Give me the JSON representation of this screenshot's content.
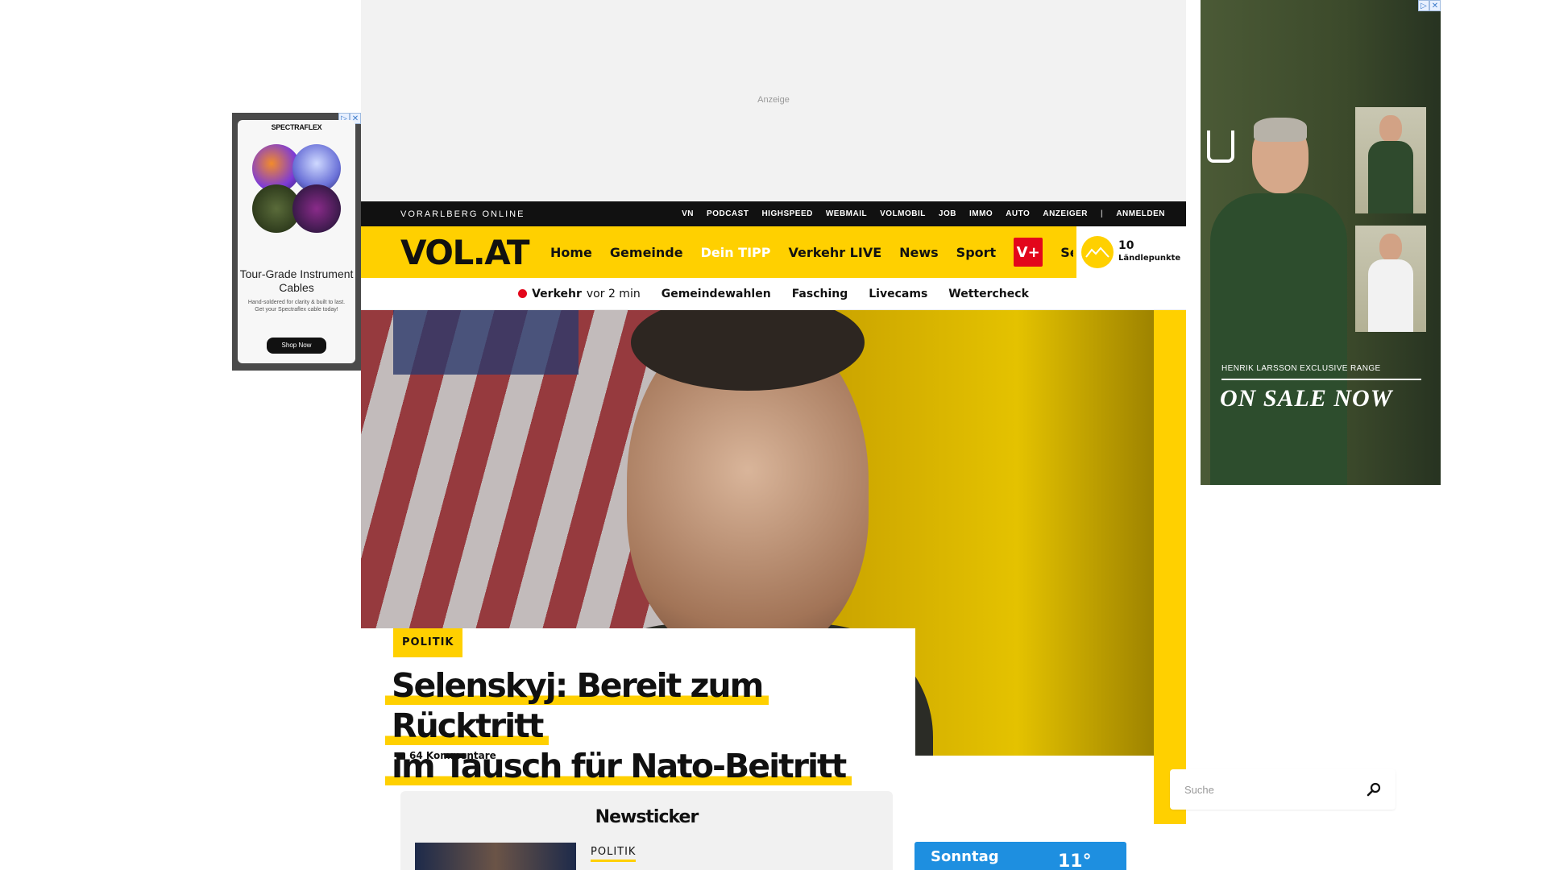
{
  "ads": {
    "top_label": "Anzeige",
    "left": {
      "brand": "SPECTRAFLEX",
      "headline": "Tour-Grade Instrument Cables",
      "sub": "Hand-soldered for clarity & built to last. Get your Spectraflex cable today!",
      "cta": "Shop Now"
    },
    "right": {
      "tagline": "HENRIK LARSSON EXCLUSIVE RANGE",
      "sale": "ON SALE NOW"
    }
  },
  "topbar": {
    "brandline": "VORARLBERG ONLINE",
    "links": [
      "VN",
      "PODCAST",
      "HIGHSPEED",
      "WEBMAIL",
      "VOLMOBIL",
      "JOB",
      "IMMO",
      "AUTO",
      "ANZEIGER"
    ],
    "login": "ANMELDEN"
  },
  "mainnav": {
    "logo": "VOL.AT",
    "items": [
      "Home",
      "Gemeinde",
      "Dein TIPP",
      "Verkehr LIVE",
      "News",
      "Sport"
    ],
    "vplus": "V+",
    "service": "Service",
    "points_value": "10",
    "points_label": "Ländlepunkte"
  },
  "subnav": {
    "live_label": "Verkehr",
    "live_time": "vor 2 min",
    "items": [
      "Gemeindewahlen",
      "Fasching",
      "Livecams",
      "Wettercheck"
    ]
  },
  "article": {
    "category": "POLITIK",
    "headline_line1": "Selenskyj: Bereit zum Rücktritt",
    "headline_line2": "im Tausch für Nato-Beitritt",
    "comments": "64 Kommentare"
  },
  "newsticker": {
    "title": "Newsticker",
    "category": "POLITIK"
  },
  "search": {
    "placeholder": "Suche"
  },
  "weather": {
    "day": "Sonntag",
    "temp": "11°"
  },
  "colors": {
    "brand_yellow": "#ffd000",
    "vplus_red": "#e3061b",
    "topbar": "#111111"
  }
}
